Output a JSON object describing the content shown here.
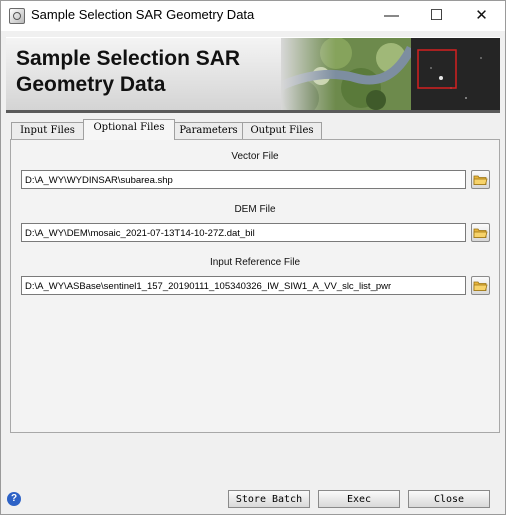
{
  "window": {
    "title": "Sample Selection SAR Geometry Data",
    "minimize_glyph": "—",
    "maximize_glyph": "☐",
    "close_glyph": "✕"
  },
  "banner": {
    "title_line1": "Sample Selection SAR",
    "title_line2": "Geometry Data"
  },
  "tabs": [
    "Input Files",
    "Optional Files",
    "Parameters",
    "Output Files"
  ],
  "active_tab": "Optional Files",
  "fields": {
    "vector": {
      "label": "Vector File",
      "value": "D:\\A_WY\\WYDINSAR\\subarea.shp"
    },
    "dem": {
      "label": "DEM File",
      "value": "D:\\A_WY\\DEM\\mosaic_2021-07-13T14-10-27Z.dat_bil"
    },
    "reference": {
      "label": "Input Reference File",
      "value": "D:\\A_WY\\ASBase\\sentinel1_157_20190111_105340326_IW_SIW1_A_VV_slc_list_pwr"
    }
  },
  "footer": {
    "help_glyph": "?",
    "store_batch": "Store Batch",
    "exec": "Exec",
    "close": "Close"
  },
  "icons": [
    "app-icon",
    "folder-icon",
    "help-icon"
  ]
}
